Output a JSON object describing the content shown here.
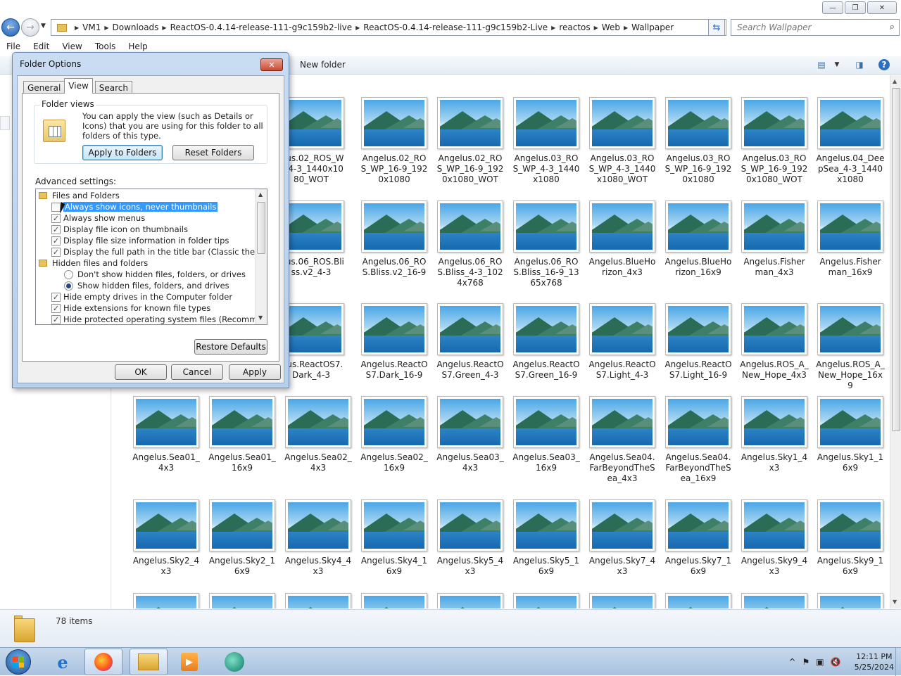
{
  "window": {
    "controls": [
      "—",
      "❐",
      "✕"
    ]
  },
  "address": {
    "crumbs": [
      "VM1",
      "Downloads",
      "ReactOS-0.4.14-release-111-g9c159b2-live",
      "ReactOS-0.4.14-release-111-g9c159b2-Live",
      "reactos",
      "Web",
      "Wallpaper"
    ]
  },
  "search": {
    "placeholder": "Search Wallpaper"
  },
  "menu": [
    "File",
    "Edit",
    "View",
    "Tools",
    "Help"
  ],
  "toolbar": {
    "new_folder": "New folder",
    "icons": [
      "change-view-icon",
      "view-dropdown-icon",
      "preview-pane-icon",
      "help-icon"
    ]
  },
  "files": [
    "elus.02_ROS_WP_4-3_1440x1080_WOT",
    "Angelus.02_ROS_WP_16-9_1920x1080",
    "Angelus.02_ROS_WP_16-9_1920x1080_WOT",
    "Angelus.03_ROS_WP_4-3_1440x1080",
    "Angelus.03_ROS_WP_4-3_1440x1080_WOT",
    "Angelus.03_ROS_WP_16-9_1920x1080",
    "Angelus.03_ROS_WP_16-9_1920x1080_WOT",
    "Angelus.04_DeepSea_4-3_1440x1080",
    "elus.06_ROS.Bliss.v2_4-3",
    "Angelus.06_ROS.Bliss.v2_16-9",
    "Angelus.06_ROS.Bliss_4-3_1024x768",
    "Angelus.06_ROS.Bliss_16-9_1365x768",
    "Angelus.BlueHorizon_4x3",
    "Angelus.BlueHorizon_16x9",
    "Angelus.Fisherman_4x3",
    "Angelus.Fisherman_16x9",
    "elus.ReactOS7.Dark_4-3",
    "Angelus.ReactOS7.Dark_16-9",
    "Angelus.ReactOS7.Green_4-3",
    "Angelus.ReactOS7.Green_16-9",
    "Angelus.ReactOS7.Light_4-3",
    "Angelus.ReactOS7.Light_16-9",
    "Angelus.ROS_A_New_Hope_4x3",
    "Angelus.ROS_A_New_Hope_16x9",
    "Angelus.Sea01_4x3",
    "Angelus.Sea01_16x9",
    "Angelus.Sea02_4x3",
    "Angelus.Sea02_16x9",
    "Angelus.Sea03_4x3",
    "Angelus.Sea03_16x9",
    "Angelus.Sea04.FarBeyondTheSea_4x3",
    "Angelus.Sea04.FarBeyondTheSea_16x9",
    "Angelus.Sky1_4x3",
    "Angelus.Sky1_16x9",
    "Angelus.Sky2_4x3",
    "Angelus.Sky2_16x9",
    "Angelus.Sky4_4x3",
    "Angelus.Sky4_16x9",
    "Angelus.Sky5_4x3",
    "Angelus.Sky5_16x9",
    "Angelus.Sky7_4x3",
    "Angelus.Sky7_16x9",
    "Angelus.Sky9_4x3",
    "Angelus.Sky9_16x9",
    "",
    "",
    "",
    "",
    "",
    "",
    "",
    "",
    "",
    ""
  ],
  "status": {
    "count": "78 items"
  },
  "taskbar": {
    "apps": [
      "ie-icon",
      "firefox-icon",
      "explorer-icon",
      "media-player-icon",
      "reactos-app-icon"
    ],
    "tray_icons": [
      "^",
      "⚑",
      "▣",
      "🔇"
    ],
    "time": "12:11 PM",
    "date": "5/25/2024"
  },
  "dialog": {
    "title": "Folder Options",
    "tabs": [
      "General",
      "View",
      "Search"
    ],
    "folder_views_label": "Folder views",
    "folder_views_text": "You can apply the view (such as Details or Icons) that you are using for this folder to all folders of this type.",
    "apply_folders": "Apply to Folders",
    "reset_folders": "Reset Folders",
    "advanced_label": "Advanced settings:",
    "settings": [
      {
        "kind": "folder",
        "label": "Files and Folders"
      },
      {
        "kind": "check",
        "checked": false,
        "selected": true,
        "label": "Always show icons, never thumbnails"
      },
      {
        "kind": "check",
        "checked": true,
        "label": "Always show menus"
      },
      {
        "kind": "check",
        "checked": true,
        "label": "Display file icon on thumbnails"
      },
      {
        "kind": "check",
        "checked": true,
        "label": "Display file size information in folder tips"
      },
      {
        "kind": "check",
        "checked": true,
        "label": "Display the full path in the title bar (Classic theme only)"
      },
      {
        "kind": "folder",
        "label": "Hidden files and folders"
      },
      {
        "kind": "radio",
        "checked": false,
        "label": "Don't show hidden files, folders, or drives"
      },
      {
        "kind": "radio",
        "checked": true,
        "label": "Show hidden files, folders, and drives"
      },
      {
        "kind": "check",
        "checked": true,
        "label": "Hide empty drives in the Computer folder"
      },
      {
        "kind": "check",
        "checked": true,
        "label": "Hide extensions for known file types"
      },
      {
        "kind": "check",
        "checked": true,
        "label": "Hide protected operating system files (Recommended)"
      }
    ],
    "restore_defaults": "Restore Defaults",
    "ok": "OK",
    "cancel": "Cancel",
    "apply": "Apply"
  }
}
